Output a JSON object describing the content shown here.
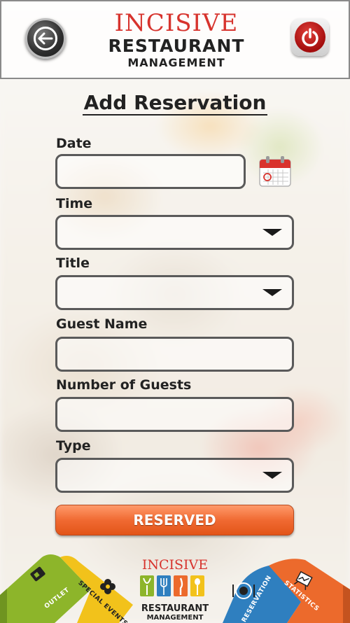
{
  "header": {
    "brand_top": "INCISIVE",
    "brand_mid": "RESTAURANT",
    "brand_sub": "MANAGEMENT"
  },
  "page": {
    "title": "Add Reservation"
  },
  "form": {
    "date_label": "Date",
    "date_value": "",
    "time_label": "Time",
    "time_value": "",
    "title_label": "Title",
    "title_value": "",
    "guest_name_label": "Guest Name",
    "guest_name_value": "",
    "guests_label": "Number of Guests",
    "guests_value": "",
    "type_label": "Type",
    "type_value": "",
    "submit_label": "RESERVED"
  },
  "bottom_nav": {
    "outlet_label": "OUTLET",
    "special_events_label": "SPECIAL EVENTS",
    "reservation_label": "RESERVATION",
    "statistics_label": "STATISTICS",
    "brand_top": "INCISIVE",
    "brand_mid": "RESTAURANT",
    "brand_sub": "MANAGEMENT"
  },
  "icons": {
    "back": "back-arrow-icon",
    "power": "power-icon",
    "calendar": "calendar-icon",
    "dropdown": "chevron-down-icon"
  },
  "colors": {
    "brand_red": "#d7332d",
    "button_orange": "#f06a32",
    "ribbon_green": "#8db52a",
    "ribbon_yellow": "#f2c21b",
    "ribbon_blue": "#2f7fbf",
    "ribbon_orange": "#ec6a2c"
  }
}
